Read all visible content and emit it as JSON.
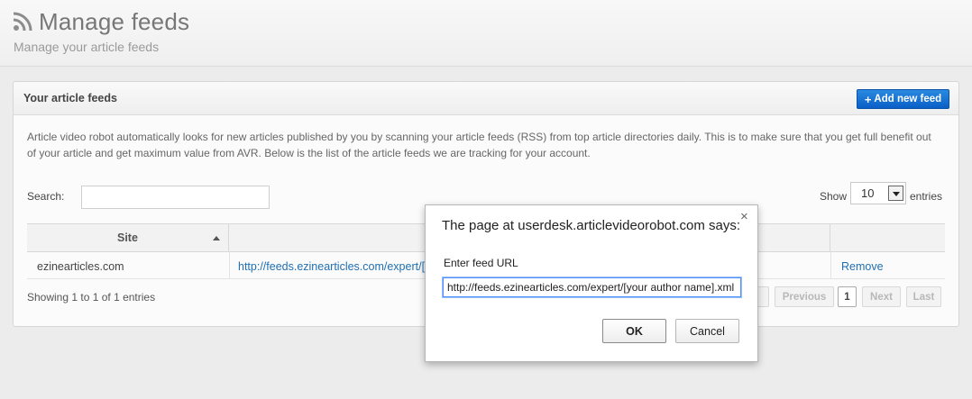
{
  "header": {
    "icon": "rss-icon",
    "title": "Manage feeds",
    "subtitle": "Manage your article feeds"
  },
  "panel": {
    "title": "Your article feeds",
    "add_button_icon": "+",
    "add_button": "Add new feed",
    "intro": "Article video robot automatically looks for new articles published by you by scanning your article feeds (RSS) from top article directories daily. This is to make sure that you get full benefit out of your article and get maximum value from AVR. Below is the list of the article feeds we are tracking for your account."
  },
  "table_controls": {
    "search_label": "Search:",
    "search_value": "",
    "show_label": "Show",
    "page_length": "10",
    "entries_label": "entries"
  },
  "table": {
    "columns": [
      "Site",
      ""
    ],
    "rows": [
      {
        "site": "ezinearticles.com",
        "url": "http://feeds.ezinearticles.com/expert/[your author name].xml",
        "action": "Remove"
      }
    ],
    "info": "Showing 1 to 1 of 1 entries",
    "pagination": {
      "first": "First",
      "previous": "Previous",
      "current": "1",
      "next": "Next",
      "last": "Last"
    }
  },
  "dialog": {
    "title": "The page at userdesk.articlevideorobot.com says:",
    "close": "×",
    "prompt": "Enter feed URL",
    "input_value": "http://feeds.ezinearticles.com/expert/[your author name].xml",
    "ok": "OK",
    "cancel": "Cancel"
  },
  "colors": {
    "accent": "#0a5fc7",
    "link": "#1f6fb2"
  }
}
